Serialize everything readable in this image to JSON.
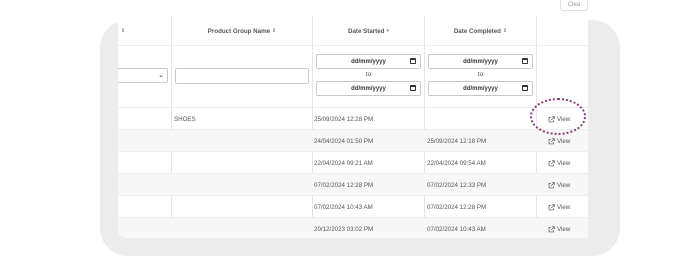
{
  "toolbar": {
    "clear_label": "Clea"
  },
  "table": {
    "headers": {
      "product_group_name": "Product Group Name",
      "date_started": "Date Started",
      "date_completed": "Date Completed",
      "sort_both": "⇕",
      "sort_desc": "▾"
    },
    "filters": {
      "date_placeholder": "dd/mm/yyyy",
      "to_label": "to"
    },
    "rows": [
      {
        "product_group": "SHOES",
        "date_started": "25/09/2024 12:28 PM",
        "date_completed": "",
        "action": "View"
      },
      {
        "product_group": "",
        "date_started": "24/04/2024 01:50 PM",
        "date_completed": "25/09/2024 12:18 PM",
        "action": "View"
      },
      {
        "product_group": "",
        "date_started": "22/04/2024 09:21 AM",
        "date_completed": "22/04/2024 09:54 AM",
        "action": "View"
      },
      {
        "product_group": "",
        "date_started": "07/02/2024 12:28 PM",
        "date_completed": "07/02/2024 12:33 PM",
        "action": "View"
      },
      {
        "product_group": "",
        "date_started": "07/02/2024 10:43 AM",
        "date_completed": "07/02/2024 12:28 PM",
        "action": "View"
      },
      {
        "product_group": "",
        "date_started": "20/12/2023 03:02 PM",
        "date_completed": "07/02/2024 10:43 AM",
        "action": "View"
      }
    ]
  },
  "colors": {
    "highlight": "#8a3c7c",
    "backdrop": "#ececec"
  }
}
